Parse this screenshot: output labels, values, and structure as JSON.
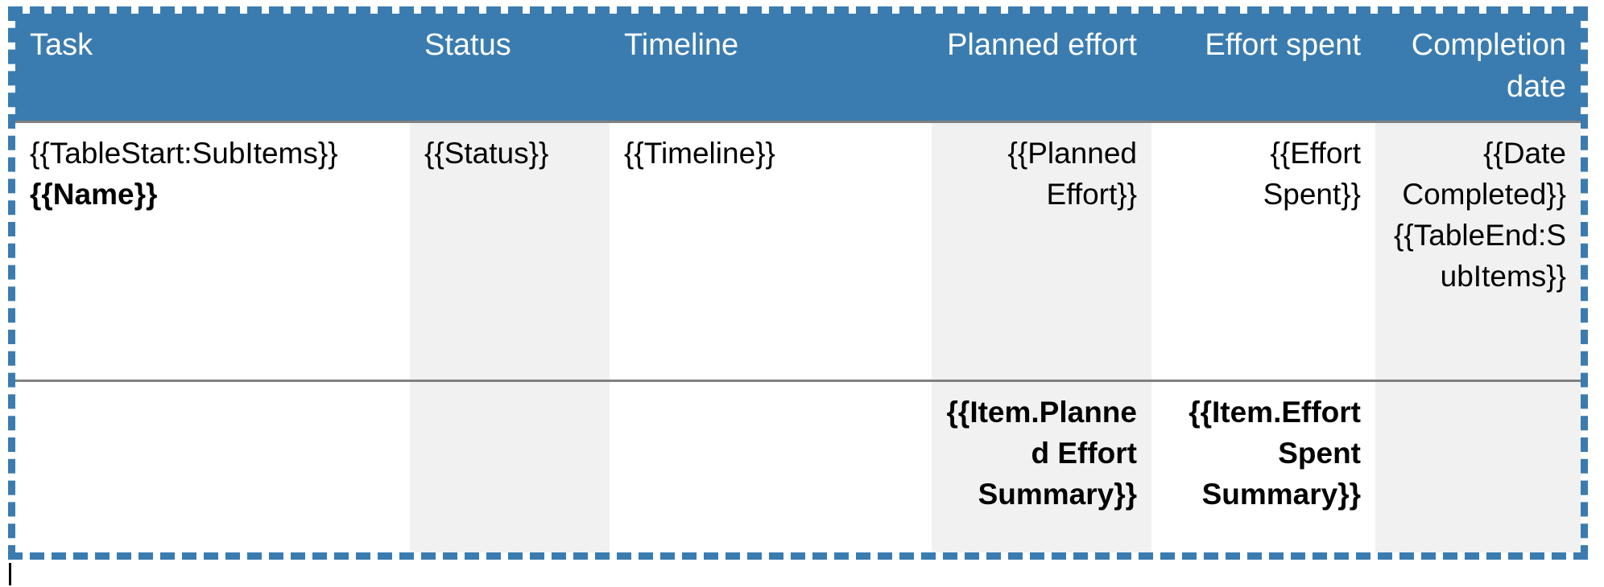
{
  "colors": {
    "header_bg": "#3a7cb0",
    "header_text": "#ffffff",
    "selection_border": "#3a7cb0",
    "shaded_cell": "#f1f1f1",
    "rule": "#808080",
    "body_text": "#000000"
  },
  "table": {
    "columns": [
      {
        "key": "task",
        "label": "Task",
        "align": "left"
      },
      {
        "key": "status",
        "label": "Status",
        "align": "left"
      },
      {
        "key": "timeline",
        "label": "Timeline",
        "align": "left"
      },
      {
        "key": "planned",
        "label": "Planned effort",
        "align": "right"
      },
      {
        "key": "effort",
        "label": "Effort spent",
        "align": "right"
      },
      {
        "key": "date",
        "label": "Completion date",
        "align": "right"
      }
    ],
    "rows": [
      {
        "name": "subitems-merge-row",
        "cells": {
          "task": {
            "lines": [
              "{{TableStart:SubItems}}",
              "{{Name}}"
            ],
            "bold_lines": [
              false,
              true
            ],
            "shaded": false,
            "align": "left"
          },
          "status": {
            "lines": [
              "{{Status}}"
            ],
            "bold_lines": [
              false
            ],
            "shaded": true,
            "align": "left"
          },
          "timeline": {
            "lines": [
              "{{Timeline}}"
            ],
            "bold_lines": [
              false
            ],
            "shaded": false,
            "align": "left"
          },
          "planned": {
            "lines": [
              "{{Planned Effort}}"
            ],
            "bold_lines": [
              false
            ],
            "shaded": true,
            "align": "right"
          },
          "effort": {
            "lines": [
              "{{Effort Spent}}"
            ],
            "bold_lines": [
              false
            ],
            "shaded": false,
            "align": "right"
          },
          "date": {
            "lines": [
              "{{Date Completed}}",
              "{{TableEnd:SubItems}}"
            ],
            "bold_lines": [
              false,
              false
            ],
            "shaded": true,
            "align": "right"
          }
        }
      },
      {
        "name": "summary-row",
        "cells": {
          "task": {
            "lines": [],
            "bold_lines": [],
            "shaded": false,
            "align": "left"
          },
          "status": {
            "lines": [],
            "bold_lines": [],
            "shaded": true,
            "align": "left"
          },
          "timeline": {
            "lines": [],
            "bold_lines": [],
            "shaded": false,
            "align": "left"
          },
          "planned": {
            "lines": [
              "{{Item.Planned Effort Summary}}"
            ],
            "bold_lines": [
              true
            ],
            "shaded": true,
            "align": "right"
          },
          "effort": {
            "lines": [
              "{{Item.Effort Spent Summary}}"
            ],
            "bold_lines": [
              true
            ],
            "shaded": false,
            "align": "right"
          },
          "date": {
            "lines": [],
            "bold_lines": [],
            "shaded": true,
            "align": "right"
          }
        }
      }
    ]
  },
  "header_cells": {
    "task": "Task",
    "status": "Status",
    "timeline": "Timeline",
    "planned": "Planned effort",
    "effort": "Effort spent",
    "date": "Completion date"
  }
}
